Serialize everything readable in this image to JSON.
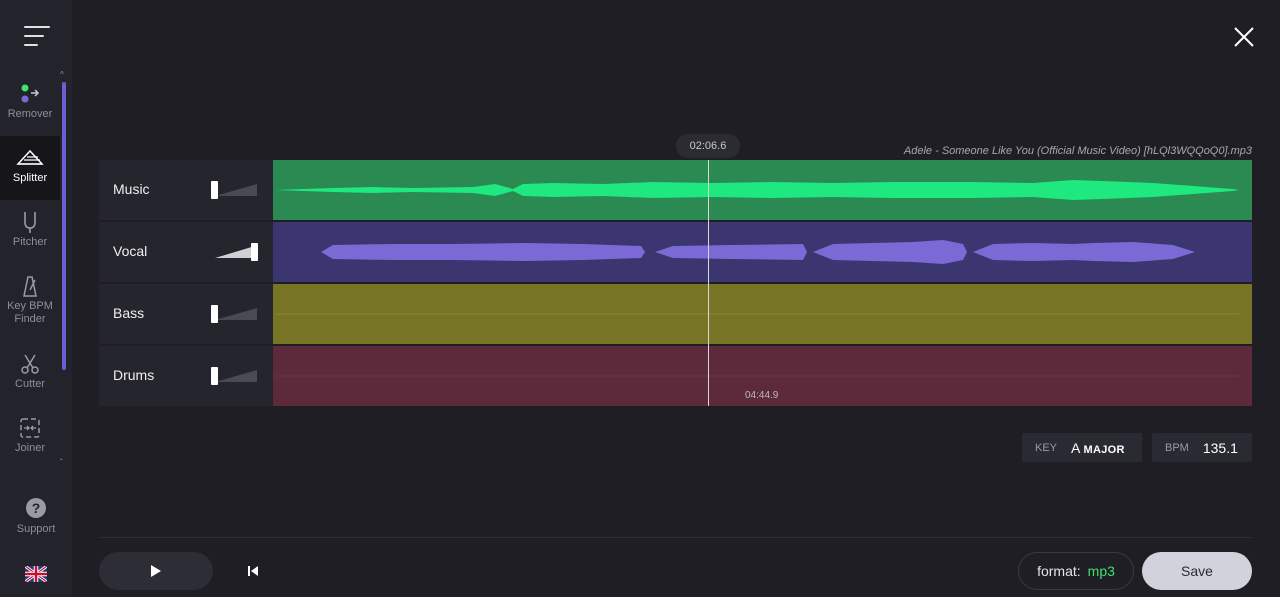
{
  "sidebar": {
    "items": [
      {
        "label": "Remover",
        "icon": "remover-icon"
      },
      {
        "label": "Splitter",
        "icon": "splitter-icon",
        "active": true
      },
      {
        "label": "Pitcher",
        "icon": "pitcher-icon"
      },
      {
        "label": "Key BPM Finder",
        "icon": "metronome-icon"
      },
      {
        "label": "Cutter",
        "icon": "scissors-icon"
      },
      {
        "label": "Joiner",
        "icon": "joiner-icon"
      }
    ],
    "support_label": "Support"
  },
  "player": {
    "current_time": "02:06.6",
    "end_time": "04:44.9",
    "filename": "Adele - Someone Like You (Official Music Video) [hLQl3WQQoQ0].mp3"
  },
  "tracks": [
    {
      "name": "Music",
      "level": 0,
      "color": "#2a8a52",
      "wave_color": "#1ee87f"
    },
    {
      "name": "Vocal",
      "level": 1,
      "color": "#3b3670",
      "wave_color": "#7b6ad6"
    },
    {
      "name": "Bass",
      "level": 0,
      "color": "#777426",
      "wave_color": "#8a8630"
    },
    {
      "name": "Drums",
      "level": 0,
      "color": "#5c2a3b",
      "wave_color": "#6b3447"
    }
  ],
  "analysis": {
    "key_label": "KEY",
    "key_value": "A",
    "key_mode": "MAJOR",
    "bpm_label": "BPM",
    "bpm_value": "135.1"
  },
  "controls": {
    "format_label": "format:",
    "format_value": "mp3",
    "save_label": "Save"
  },
  "colors": {
    "accent": "#6b5fd1",
    "format_value": "#3ee36a"
  }
}
